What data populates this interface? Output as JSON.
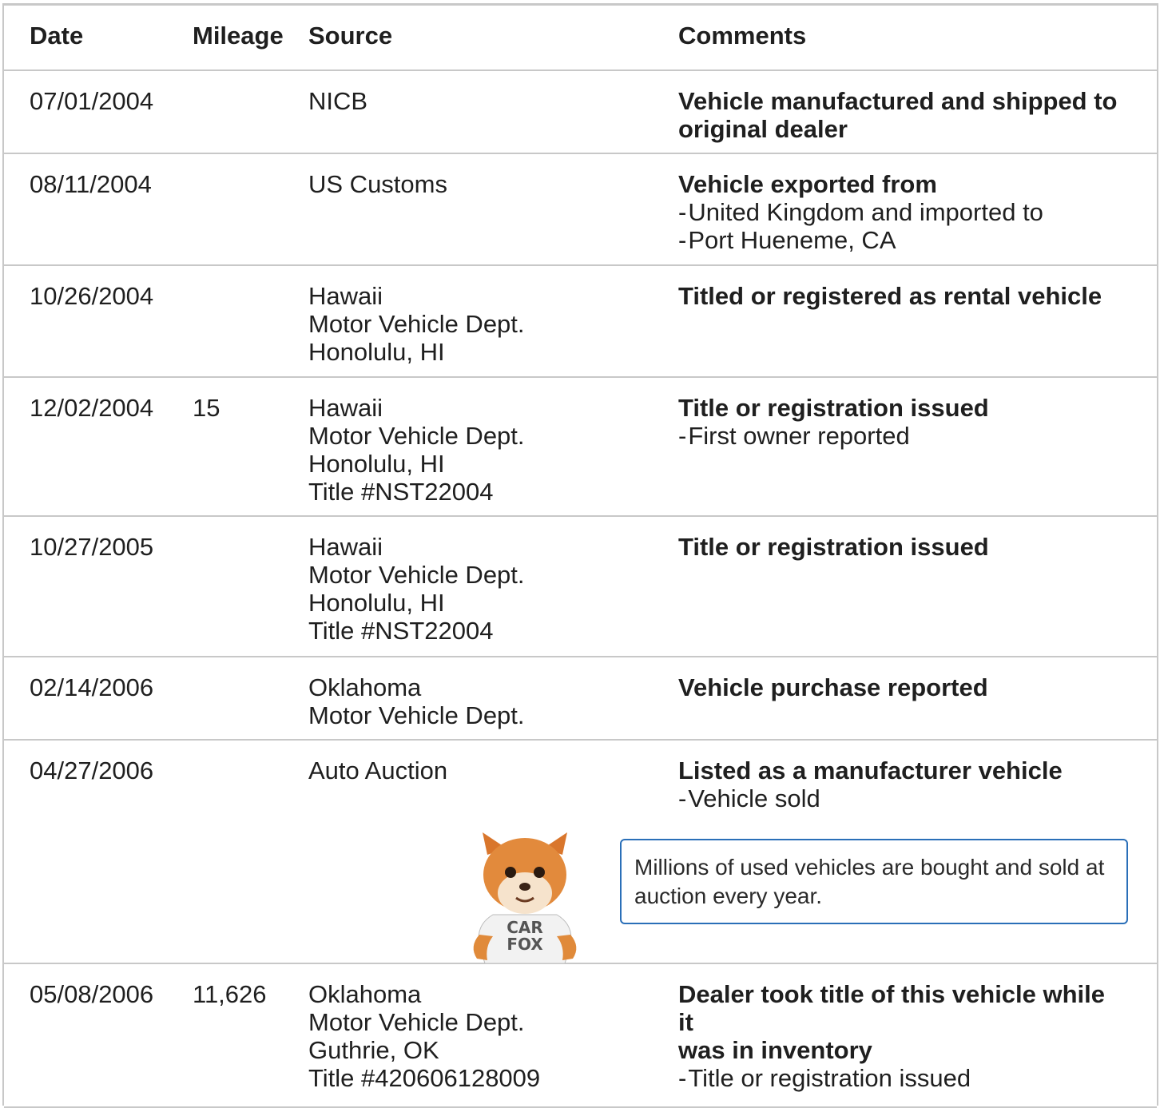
{
  "columns": [
    "Date",
    "Mileage",
    "Source",
    "Comments"
  ],
  "rows": [
    {
      "date": "07/01/2004",
      "mileage": "",
      "source": [
        "NICB"
      ],
      "comment_title": [
        "Vehicle manufactured and shipped to",
        "original dealer"
      ],
      "comment_items": []
    },
    {
      "date": "08/11/2004",
      "mileage": "",
      "source": [
        "US Customs"
      ],
      "comment_title": [
        "Vehicle exported from"
      ],
      "comment_items": [
        "United Kingdom and imported to",
        "Port Hueneme, CA"
      ]
    },
    {
      "date": "10/26/2004",
      "mileage": "",
      "source": [
        "Hawaii",
        "Motor Vehicle Dept.",
        "Honolulu, HI"
      ],
      "comment_title": [
        "Titled or registered as rental vehicle"
      ],
      "comment_items": []
    },
    {
      "date": "12/02/2004",
      "mileage": "15",
      "source": [
        "Hawaii",
        "Motor Vehicle Dept.",
        "Honolulu, HI",
        "Title #NST22004"
      ],
      "comment_title": [
        "Title or registration issued"
      ],
      "comment_items": [
        "First owner reported"
      ]
    },
    {
      "date": "10/27/2005",
      "mileage": "",
      "source": [
        "Hawaii",
        "Motor Vehicle Dept.",
        "Honolulu, HI",
        "Title #NST22004"
      ],
      "comment_title": [
        "Title or registration issued"
      ],
      "comment_items": []
    },
    {
      "date": "02/14/2006",
      "mileage": "",
      "source": [
        "Oklahoma",
        "Motor Vehicle Dept."
      ],
      "comment_title": [
        "Vehicle purchase reported"
      ],
      "comment_items": []
    },
    {
      "date": "04/27/2006",
      "mileage": "",
      "source": [
        "Auto Auction"
      ],
      "comment_title": [
        "Listed as a manufacturer vehicle"
      ],
      "comment_items": [
        "Vehicle sold"
      ]
    },
    {
      "date": "05/08/2006",
      "mileage": "11,626",
      "source": [
        "Oklahoma",
        "Motor Vehicle Dept.",
        "Guthrie, OK",
        "Title #420606128009"
      ],
      "comment_title": [
        "Dealer took title of this vehicle while it",
        "was in inventory"
      ],
      "comment_items": [
        "Title or registration issued"
      ]
    }
  ],
  "tip": {
    "text": "Millions of used vehicles are bought and sold at auction every year.",
    "mascot_shirt": [
      "CAR",
      "FOX"
    ]
  },
  "colors": {
    "border": "#c8c8c8",
    "tip_border": "#2a6fb8",
    "text": "#1f1f1f"
  },
  "icons": {
    "mascot": "car-fox-mascot-icon"
  }
}
